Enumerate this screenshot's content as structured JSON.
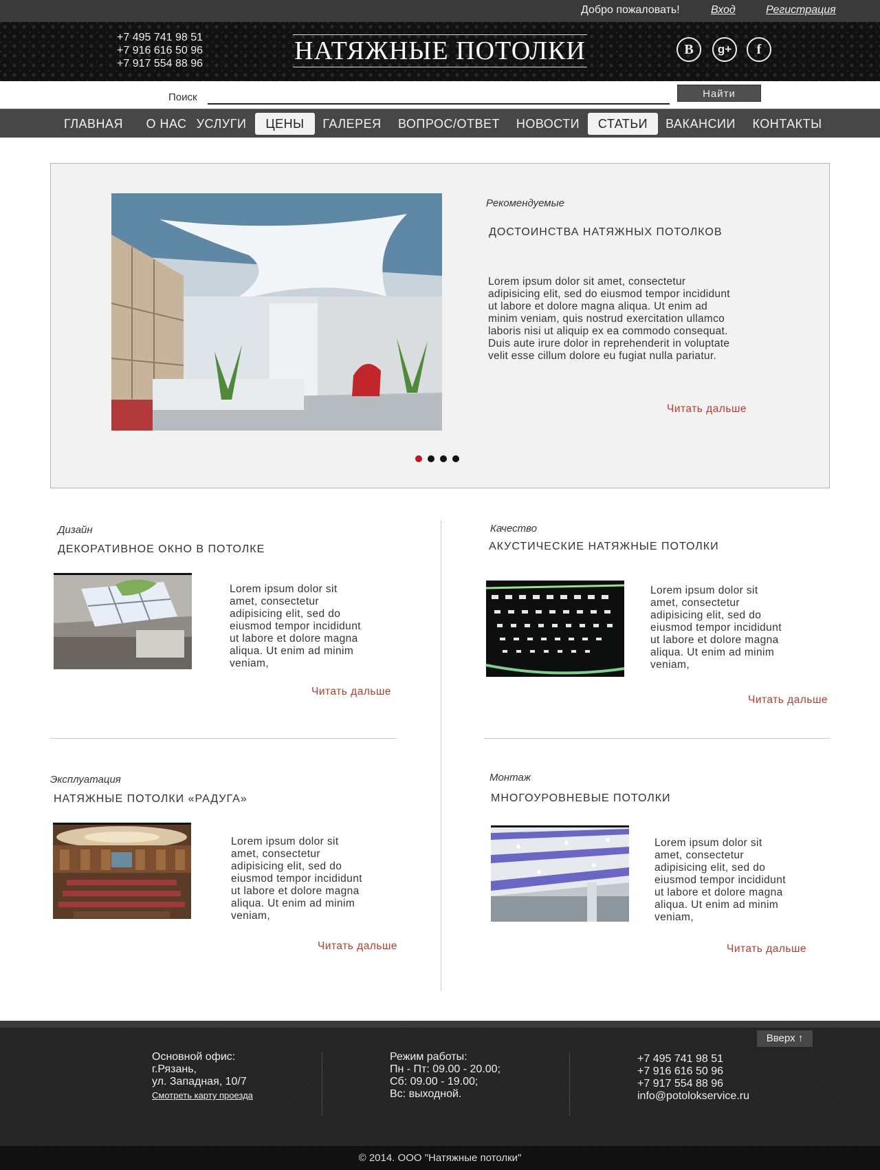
{
  "topbar": {
    "welcome": "Добро пожаловать!",
    "login": "Вход",
    "register": "Регистрация"
  },
  "header": {
    "phones": [
      "+7 495 741 98 51",
      "+7 916 616 50 96",
      "+7 917 554 88 96"
    ],
    "logo": "НАТЯЖНЫЕ  ПОТОЛКИ",
    "social": [
      {
        "glyph": "B",
        "icon": "vk-icon"
      },
      {
        "glyph": "g+",
        "icon": "google-plus-icon"
      },
      {
        "glyph": "f",
        "icon": "facebook-icon"
      }
    ]
  },
  "search": {
    "label": "Поиск",
    "value": "",
    "button": "Найти"
  },
  "nav": {
    "items": [
      "ГЛАВНАЯ",
      "О НАС",
      "УСЛУГИ",
      "ЦЕНЫ",
      "ГАЛЕРЕЯ",
      "ВОПРОС/ОТВЕТ",
      "НОВОСТИ",
      "СТАТЬИ",
      "ВАКАНСИИ",
      "КОНТАКТЫ"
    ],
    "active": [
      "ЦЕНЫ",
      "СТАТЬИ"
    ]
  },
  "featured": {
    "category": "Рекомендуемые",
    "title": "ДОСТОИНСТВА НАТЯЖНЫХ ПОТОЛКОВ",
    "text": "Lorem ipsum dolor sit amet, consectetur adipisicing elit, sed do eiusmod tempor incididunt ut labore et dolore magna aliqua. Ut enim ad minim veniam, quis nostrud exercitation ullamco laboris nisi ut aliquip ex ea commodo consequat. Duis aute irure dolor in reprehenderit in voluptate velit esse cillum dolore eu fugiat nulla pariatur.",
    "more": "Читать дальше",
    "slides": 4,
    "active_slide": 1
  },
  "articles": [
    {
      "category": "Дизайн",
      "title": "ДЕКОРАТИВНОЕ ОКНО В ПОТОЛКЕ",
      "text": "Lorem ipsum dolor sit amet, consectetur adipisicing elit, sed do eiusmod tempor incididunt ut labore et dolore magna aliqua. Ut enim ad minim veniam,",
      "more": "Читать дальше"
    },
    {
      "category": "Качество",
      "title": "АКУСТИЧЕСКИЕ НАТЯЖНЫЕ ПОТОЛКИ",
      "text": "Lorem ipsum dolor sit amet, consectetur adipisicing elit, sed do eiusmod tempor incididunt ut labore et dolore magna aliqua. Ut enim ad minim veniam,",
      "more": "Читать дальше"
    },
    {
      "category": "Эксплуатация",
      "title": "НАТЯЖНЫЕ ПОТОЛКИ «РАДУГА»",
      "text": "Lorem ipsum dolor sit amet, consectetur adipisicing elit, sed do eiusmod tempor incididunt ut labore et dolore magna aliqua. Ut enim ad minim veniam,",
      "more": "Читать дальше"
    },
    {
      "category": "Монтаж",
      "title": "МНОГОУРОВНЕВЫЕ ПОТОЛКИ",
      "text": "Lorem ipsum dolor sit amet, consectetur adipisicing elit, sed do eiusmod tempor incididunt ut labore et dolore magna aliqua. Ut enim ad minim veniam,",
      "more": "Читать дальше"
    }
  ],
  "footer": {
    "up": "Вверх ↑",
    "office": [
      "Основной офис:",
      "г.Рязань,",
      "ул. Западная, 10/7"
    ],
    "map_link": "Смотреть карту проезда",
    "hours": [
      "Режим работы:",
      "Пн - Пт: 09.00 - 20.00;",
      "Сб: 09.00 - 19.00;",
      "Вс: выходной."
    ],
    "contacts": [
      "+7 495 741 98 51",
      "+7 916 616 50 96",
      "+7 917 554 88 96",
      "info@potolokservice.ru"
    ],
    "copyright": "© 2014. ООО \"Натяжные потолки\""
  },
  "colors": {
    "accent": "#c0392b",
    "dark": "#3a3a3a",
    "nav": "#474747",
    "panel": "#f2f2f2"
  }
}
